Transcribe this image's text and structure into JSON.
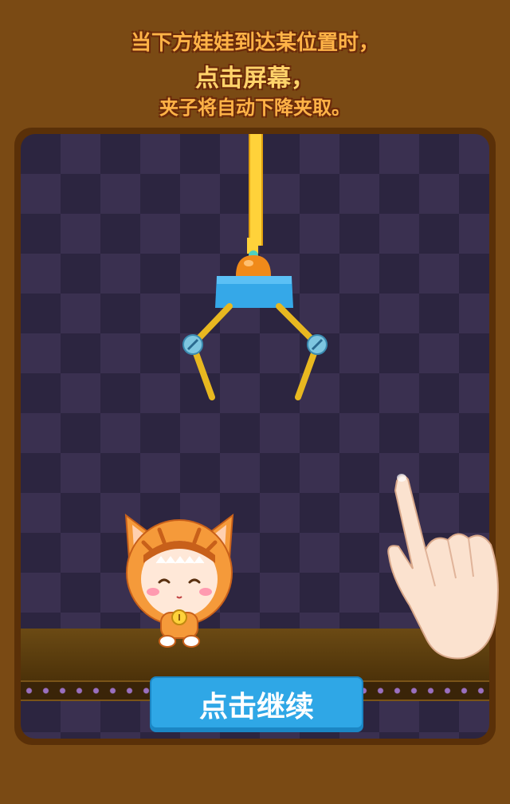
{
  "instructions": {
    "line1": "当下方娃娃到达某位置时，",
    "line2": "点击屏幕，",
    "line3": "夹子将自动下降夹取。"
  },
  "continue_button": {
    "label": "点击继续"
  },
  "icons": {
    "claw": "claw-icon",
    "doll": "tiger-doll-icon",
    "hand": "pointing-hand-icon"
  },
  "colors": {
    "background": "#7a4a14",
    "button": "#2fa7e6",
    "claw_body": "#35a8e8",
    "rope": "#ffd23a"
  }
}
